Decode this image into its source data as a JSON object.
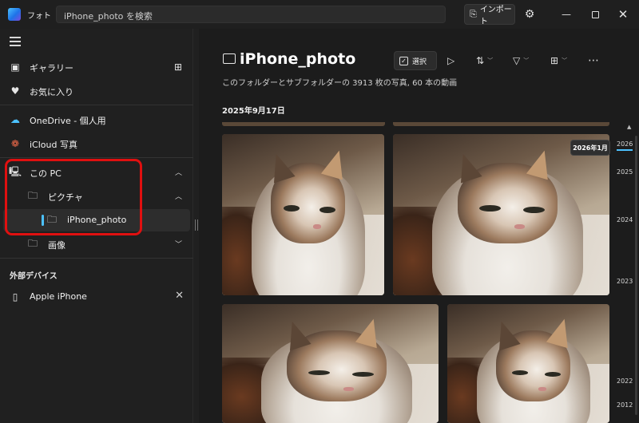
{
  "titlebar": {
    "app_title": "フォト",
    "search_placeholder": "iPhone_photo を検索",
    "import_label": "インポート",
    "icons": [
      "photos-app-icon",
      "settings-icon",
      "minimize-icon",
      "maximize-icon",
      "close-icon"
    ]
  },
  "sidebar": {
    "items": [
      {
        "label": "ギャラリー",
        "icon": "gallery-icon"
      },
      {
        "label": "お気に入り",
        "icon": "heart-icon"
      },
      {
        "label": "OneDrive - 個人用",
        "icon": "onedrive-icon"
      },
      {
        "label": "iCloud 写真",
        "icon": "icloud-icon"
      },
      {
        "label": "この PC",
        "icon": "pc-icon"
      },
      {
        "label": "ピクチャ",
        "icon": "folder-icon"
      },
      {
        "label": "iPhone_photo",
        "icon": "folder-icon",
        "selected": true
      },
      {
        "label": "画像",
        "icon": "folder-icon"
      }
    ],
    "external_section": "外部デバイス",
    "devices": [
      {
        "label": "Apple iPhone",
        "icon": "phone-icon"
      }
    ]
  },
  "main": {
    "folder_title": "iPhone_photo",
    "select_label": "選択",
    "subtitle": "このフォルダーとサブフォルダーの 3913 枚の写真, 60 本の動画",
    "date_group": "2025年9月17日"
  },
  "timeline": {
    "tooltip": "2026年1月",
    "years": [
      "2026",
      "2025",
      "2024",
      "2023",
      "2022",
      "2012"
    ]
  },
  "colors": {
    "accent": "#4cc2ff",
    "highlight_box": "#e01010",
    "background": "#1c1c1c"
  }
}
